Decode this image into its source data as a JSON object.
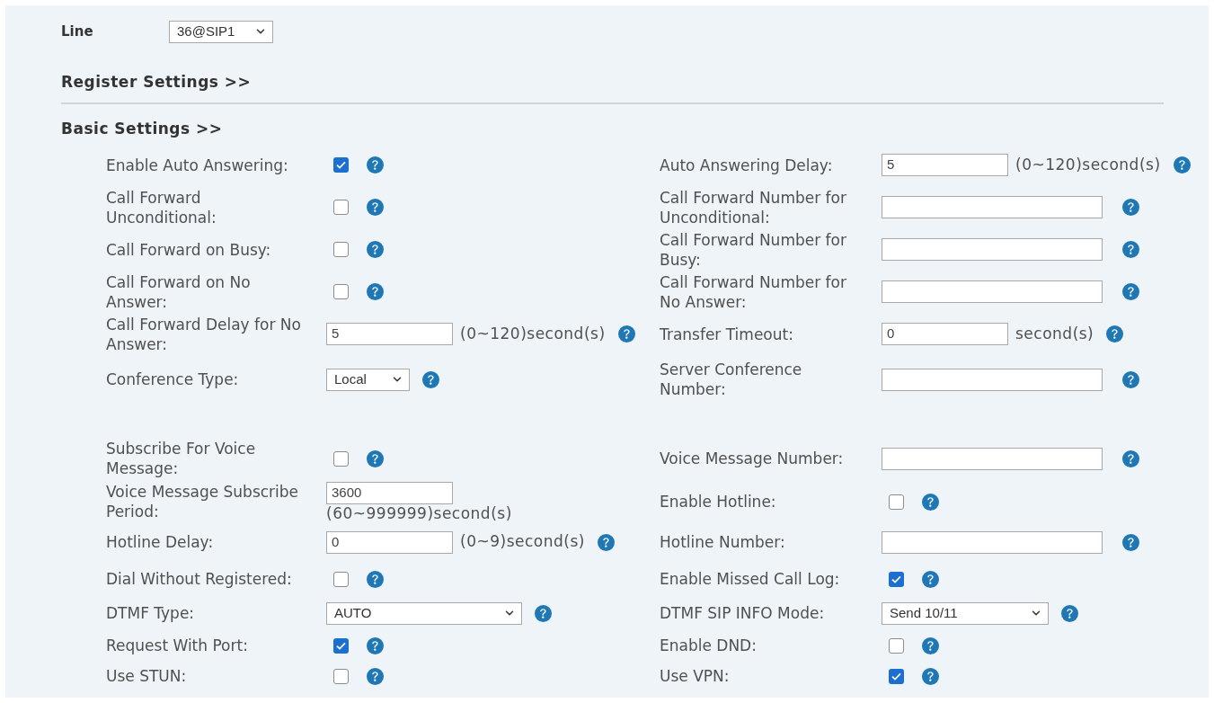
{
  "line": {
    "label": "Line",
    "value": "36@SIP1"
  },
  "register_settings": {
    "title": "Register Settings >>"
  },
  "basic_settings": {
    "title": "Basic Settings >>",
    "rows": [
      {
        "left": {
          "kind": "checkbox",
          "label": "Enable Auto Answering:",
          "checked": true,
          "help": true
        },
        "right": {
          "kind": "input",
          "label": "Auto Answering Delay:",
          "value": "5",
          "unit": "(0~120)second(s)",
          "help": true
        }
      },
      {
        "left": {
          "kind": "checkbox",
          "label": "Call Forward Unconditional:",
          "checked": false,
          "help": true
        },
        "right": {
          "kind": "input",
          "label": "Call Forward Number for Unconditional:",
          "help": true
        }
      },
      {
        "left": {
          "kind": "checkbox",
          "label": "Call Forward on Busy:",
          "checked": false,
          "help": true
        },
        "right": {
          "kind": "input",
          "label": "Call Forward Number for Busy:",
          "help": true
        }
      },
      {
        "left": {
          "kind": "checkbox",
          "label": "Call Forward on No Answer:",
          "checked": false,
          "help": true
        },
        "right": {
          "kind": "input",
          "label": "Call Forward Number for No Answer:",
          "help": true
        }
      },
      {
        "left": {
          "kind": "input",
          "label": "Call Forward Delay for No Answer:",
          "value": "5",
          "unit": "(0~120)second(s)",
          "help": true
        },
        "right": {
          "kind": "input",
          "label": "Transfer Timeout:",
          "value": "0",
          "unit": "second(s)",
          "help": true
        }
      },
      {
        "left": {
          "kind": "select",
          "label": "Conference Type:",
          "value": "Local",
          "help": true
        },
        "right": {
          "kind": "input",
          "label": "Server Conference Number:",
          "help": true
        }
      },
      {
        "left": {
          "kind": "checkbox",
          "label": "Subscribe For Voice Message:",
          "checked": false,
          "help": true
        },
        "right": {
          "kind": "input",
          "label": "Voice Message Number:",
          "help": true
        }
      },
      {
        "left": {
          "kind": "input_stacked",
          "label": "Voice Message Subscribe Period:",
          "value": "3600",
          "unit": "(60~999999)second(s)",
          "help": false
        },
        "right": {
          "kind": "checkbox",
          "label": "Enable Hotline:",
          "checked": false,
          "help": true
        }
      },
      {
        "left": {
          "kind": "input",
          "label": "Hotline Delay:",
          "value": "0",
          "unit": "(0~9)second(s)",
          "help": true
        },
        "right": {
          "kind": "input",
          "label": "Hotline Number:",
          "help": true
        }
      },
      {
        "left": {
          "kind": "checkbox",
          "label": "Dial Without Registered:",
          "checked": false,
          "help": true
        },
        "right": {
          "kind": "checkbox",
          "label": "Enable Missed Call Log:",
          "checked": true,
          "help": true
        }
      },
      {
        "left": {
          "kind": "select",
          "label": "DTMF Type:",
          "value": "AUTO",
          "help": true
        },
        "right": {
          "kind": "select",
          "label": "DTMF SIP INFO Mode:",
          "value": "Send 10/11",
          "help": true
        }
      },
      {
        "left": {
          "kind": "checkbox",
          "label": "Request With Port:",
          "checked": true,
          "help": true
        },
        "right": {
          "kind": "checkbox",
          "label": "Enable DND:",
          "checked": false,
          "help": true
        }
      },
      {
        "left": {
          "kind": "checkbox",
          "label": "Use STUN:",
          "checked": false,
          "help": true
        },
        "right": {
          "kind": "checkbox",
          "label": "Use VPN:",
          "checked": true,
          "help": true
        }
      }
    ]
  }
}
